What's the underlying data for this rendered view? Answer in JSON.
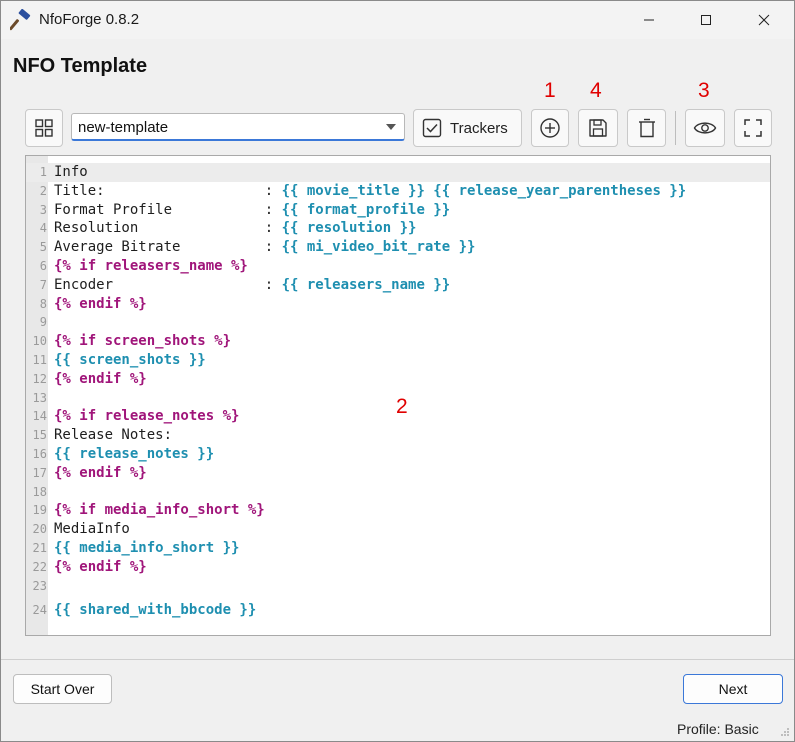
{
  "window": {
    "title": "NfoForge 0.8.2"
  },
  "page": {
    "title": "NFO Template"
  },
  "toolbar": {
    "template_value": "new-template",
    "trackers_label": "Trackers"
  },
  "annotations": {
    "a1": "1",
    "a4": "4",
    "a3": "3",
    "a2": "2"
  },
  "editor": {
    "lines": [
      {
        "n": "1",
        "tokens": [
          [
            "plain",
            "Info"
          ]
        ]
      },
      {
        "n": "2",
        "tokens": [
          [
            "plain",
            "Title:                   : "
          ],
          [
            "var",
            "{{ movie_title }} {{ release_year_parentheses }}"
          ]
        ]
      },
      {
        "n": "3",
        "tokens": [
          [
            "plain",
            "Format Profile           : "
          ],
          [
            "var",
            "{{ format_profile }}"
          ]
        ]
      },
      {
        "n": "4",
        "tokens": [
          [
            "plain",
            "Resolution               : "
          ],
          [
            "var",
            "{{ resolution }}"
          ]
        ]
      },
      {
        "n": "5",
        "tokens": [
          [
            "plain",
            "Average Bitrate          : "
          ],
          [
            "var",
            "{{ mi_video_bit_rate }}"
          ]
        ]
      },
      {
        "n": "6",
        "tokens": [
          [
            "tag",
            "{% if releasers_name %}"
          ]
        ]
      },
      {
        "n": "7",
        "tokens": [
          [
            "plain",
            "Encoder                  : "
          ],
          [
            "var",
            "{{ releasers_name }}"
          ]
        ]
      },
      {
        "n": "8",
        "tokens": [
          [
            "tag",
            "{% endif %}"
          ]
        ]
      },
      {
        "n": "9",
        "tokens": []
      },
      {
        "n": "10",
        "tokens": [
          [
            "tag",
            "{% if screen_shots %}"
          ]
        ]
      },
      {
        "n": "11",
        "tokens": [
          [
            "var",
            "{{ screen_shots }}"
          ]
        ]
      },
      {
        "n": "12",
        "tokens": [
          [
            "tag",
            "{% endif %}"
          ]
        ]
      },
      {
        "n": "13",
        "tokens": []
      },
      {
        "n": "14",
        "tokens": [
          [
            "tag",
            "{% if release_notes %}"
          ]
        ]
      },
      {
        "n": "15",
        "tokens": [
          [
            "plain",
            "Release Notes:"
          ]
        ]
      },
      {
        "n": "16",
        "tokens": [
          [
            "var",
            "{{ release_notes }}"
          ]
        ]
      },
      {
        "n": "17",
        "tokens": [
          [
            "tag",
            "{% endif %}"
          ]
        ]
      },
      {
        "n": "18",
        "tokens": []
      },
      {
        "n": "19",
        "tokens": [
          [
            "tag",
            "{% if media_info_short %}"
          ]
        ]
      },
      {
        "n": "20",
        "tokens": [
          [
            "plain",
            "MediaInfo"
          ]
        ]
      },
      {
        "n": "21",
        "tokens": [
          [
            "var",
            "{{ media_info_short }}"
          ]
        ]
      },
      {
        "n": "22",
        "tokens": [
          [
            "tag",
            "{% endif %}"
          ]
        ]
      },
      {
        "n": "23",
        "tokens": []
      },
      {
        "n": "24",
        "tokens": [
          [
            "var",
            "{{ shared_with_bbcode }}"
          ]
        ]
      }
    ]
  },
  "footer": {
    "start_over_label": "Start Over",
    "next_label": "Next",
    "status": "Profile: Basic"
  },
  "icons": {
    "app": "hammer-icon",
    "minimize": "minimize-icon",
    "maximize": "maximize-icon",
    "close": "close-icon",
    "layout": "grid-icon",
    "trackers": "checkbox-icon",
    "add": "plus-circle-icon",
    "save": "save-icon",
    "delete": "trash-icon",
    "preview": "eye-icon",
    "fullscreen": "fullscreen-icon"
  },
  "colors": {
    "annotation": "#e00000",
    "template_variable": "#1e8fb0",
    "template_tag": "#a0157a",
    "focus_accent": "#3b78d8"
  }
}
